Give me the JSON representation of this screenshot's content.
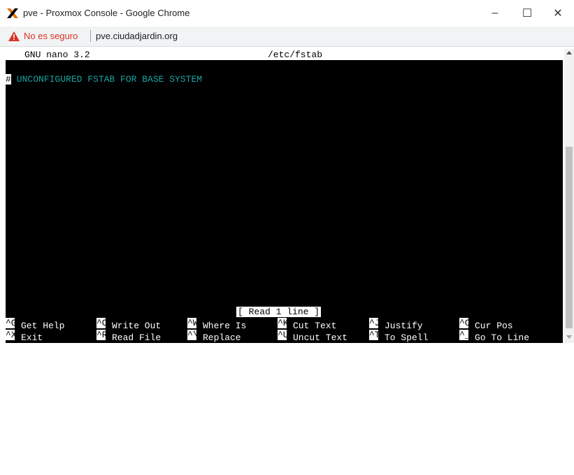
{
  "window": {
    "title": "pve - Proxmox Console - Google Chrome",
    "app_icon": "proxmox-x-icon",
    "controls": {
      "minimize": "–",
      "maximize": "☐",
      "close": "✕"
    }
  },
  "address_bar": {
    "security_icon": "warning-triangle-icon",
    "security_text": "No es seguro",
    "url": "pve.ciudadjardin.org"
  },
  "nano": {
    "version": "GNU nano 3.2",
    "filename": "/etc/fstab",
    "lines": [
      {
        "cursor_char": "#",
        "text": " UNCONFIGURED FSTAB FOR BASE SYSTEM"
      }
    ],
    "status": "[ Read 1 line ]",
    "shortcuts_row1": [
      {
        "key": "^G",
        "label": "Get Help"
      },
      {
        "key": "^O",
        "label": "Write Out"
      },
      {
        "key": "^W",
        "label": "Where Is"
      },
      {
        "key": "^K",
        "label": "Cut Text"
      },
      {
        "key": "^J",
        "label": "Justify"
      },
      {
        "key": "^C",
        "label": "Cur Pos"
      }
    ],
    "shortcuts_row2": [
      {
        "key": "^X",
        "label": "Exit"
      },
      {
        "key": "^R",
        "label": "Read File"
      },
      {
        "key": "^\\",
        "label": "Replace"
      },
      {
        "key": "^U",
        "label": "Uncut Text"
      },
      {
        "key": "^T",
        "label": "To Spell"
      },
      {
        "key": "^_",
        "label": "Go To Line"
      }
    ]
  },
  "colors": {
    "terminal_bg": "#000000",
    "comment_text": "#1aa3a3",
    "insecure_red": "#d93025"
  }
}
